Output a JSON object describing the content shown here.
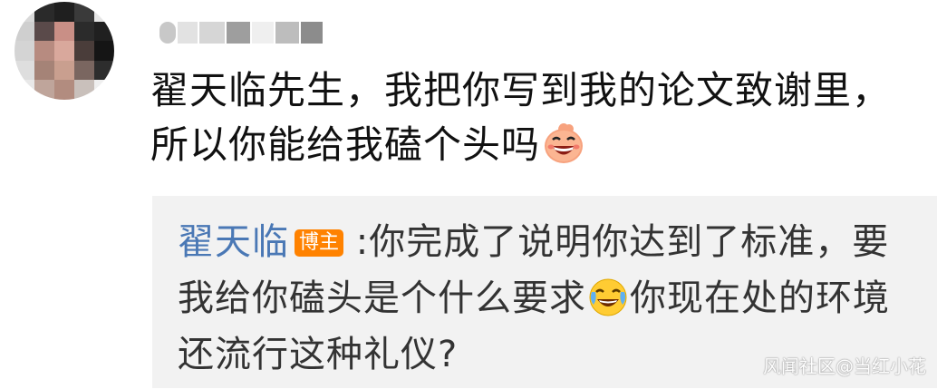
{
  "comment": {
    "avatar_icon": "blurred-avatar",
    "line1": "翟天临先生，我把你写到我的论文致谢里，",
    "line2": "所以你能给我磕个头吗",
    "emoji": "grinning-face-emoji"
  },
  "reply": {
    "author": "翟天临",
    "badge": "博主",
    "line1_text": ":你完成了说明你达到了标准，要",
    "line2_text": "我给你磕头是个什么要求",
    "emoji": "laughing-crying-emoji",
    "line2_after": "你现在处的环境",
    "line3": "还流行这种礼仪?"
  },
  "watermark": "风闻社区@当红小花",
  "colors": {
    "author_link": "#4a78b5",
    "badge_bg": "#ff8200",
    "reply_bg": "#f2f2f2"
  }
}
